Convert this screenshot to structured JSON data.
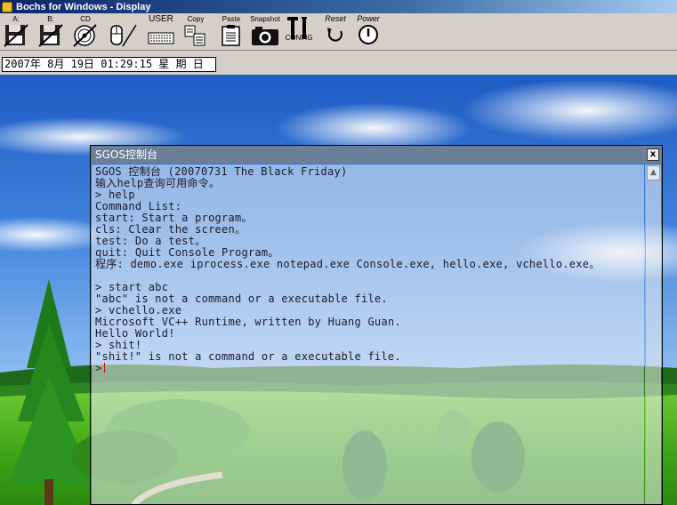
{
  "window": {
    "title": "Bochs for Windows - Display"
  },
  "toolbar": {
    "floppy_a": "A:",
    "floppy_b": "B:",
    "cdrom": "CD",
    "user": "USER",
    "copy": "Copy",
    "paste": "Paste",
    "snapshot": "Snapshot",
    "config": "CONFIG",
    "reset": "Reset",
    "power": "Power"
  },
  "status": {
    "datetime": "2007年 8月 19日  01:29:15  星 期 日"
  },
  "console": {
    "title": "SGOS控制台",
    "close": "x",
    "lines": [
      "SGOS 控制台 (20070731 The Black Friday)",
      "输入help查询可用命令。",
      "> help",
      "Command List:",
      "start: Start a program。",
      "cls: Clear the screen。",
      "test: Do a test。",
      "quit: Quit Console Program。",
      "程序: demo.exe iprocess.exe notepad.exe Console.exe, hello.exe, vchello.exe。",
      "",
      "> start abc",
      "\"abc\" is not a command or a executable file.",
      "> vchello.exe",
      "Microsoft VC++ Runtime, written by Huang Guan.",
      "Hello World!",
      "> shit!",
      "\"shit!\" is not a command or a executable file.",
      ">"
    ]
  },
  "colors": {
    "sky_top": "#2a64c8",
    "grass": "#3aa418",
    "console_title": "#6b7f98"
  }
}
